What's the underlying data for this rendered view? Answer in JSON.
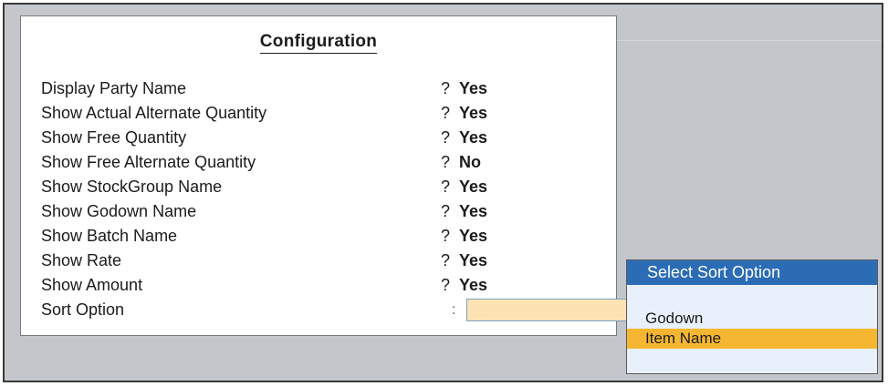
{
  "config": {
    "title": "Configuration",
    "rows": [
      {
        "label": "Display Party Name",
        "q": "?",
        "value": "Yes"
      },
      {
        "label": "Show Actual Alternate Quantity",
        "q": "?",
        "value": "Yes"
      },
      {
        "label": "Show Free Quantity",
        "q": "?",
        "value": "Yes"
      },
      {
        "label": "Show Free Alternate Quantity",
        "q": "?",
        "value": "No"
      },
      {
        "label": "Show StockGroup Name",
        "q": "?",
        "value": "Yes"
      },
      {
        "label": "Show Godown Name",
        "q": "?",
        "value": "Yes"
      },
      {
        "label": "Show Batch Name",
        "q": "?",
        "value": "Yes"
      },
      {
        "label": "Show Rate",
        "q": "?",
        "value": "Yes"
      },
      {
        "label": "Show Amount",
        "q": "?",
        "value": "Yes"
      }
    ],
    "sort_option": {
      "label": "Sort Option",
      "colon": ":",
      "value": ""
    }
  },
  "sort_popup": {
    "title": "Select Sort Option",
    "items": [
      "Godown",
      "Item Name"
    ],
    "selected": "Item Name"
  },
  "colors": {
    "background": "#c3c6ca",
    "popup_header": "#2c6cb5",
    "selection_highlight": "#f5b731",
    "input_fill": "#fbe4b2"
  }
}
